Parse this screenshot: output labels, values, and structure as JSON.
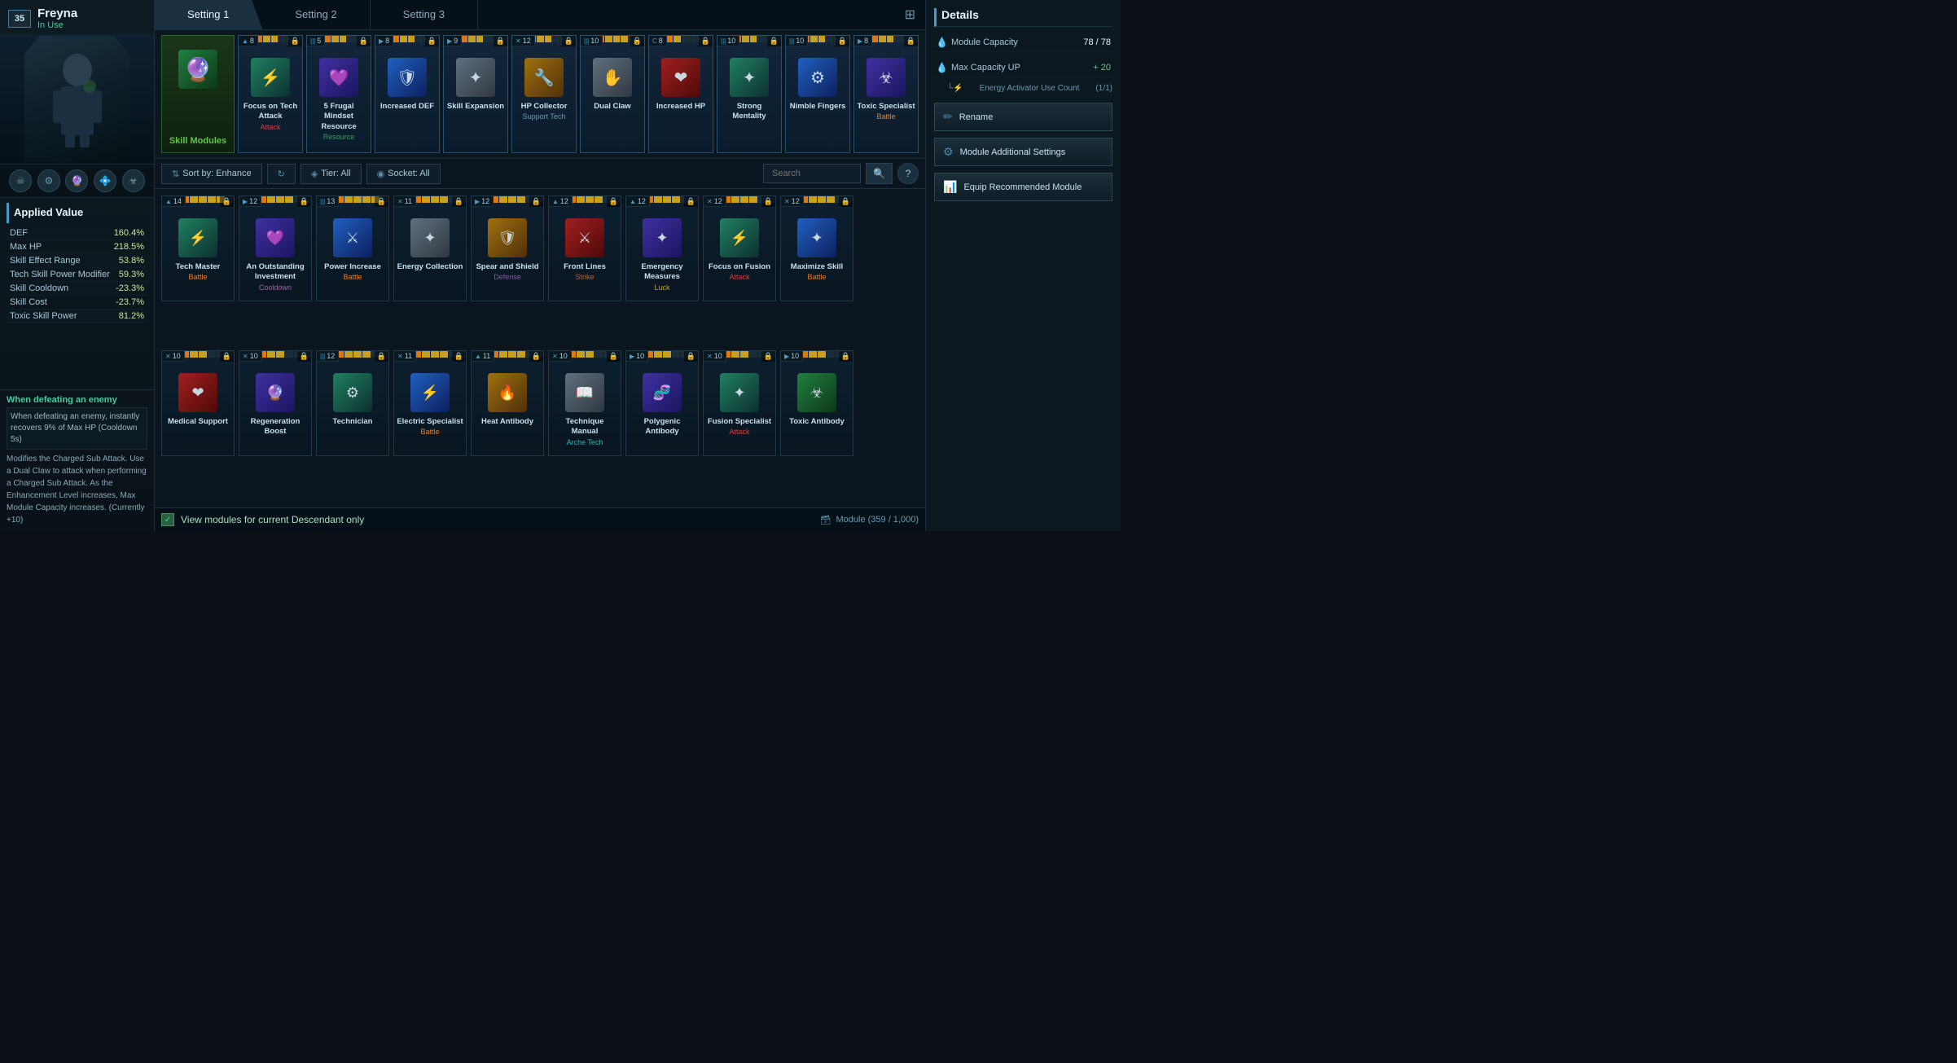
{
  "character": {
    "level": "35",
    "name": "Freyna",
    "status": "In Use"
  },
  "tabs": [
    {
      "label": "Setting 1",
      "active": true
    },
    {
      "label": "Setting 2",
      "active": false
    },
    {
      "label": "Setting 3",
      "active": false
    }
  ],
  "details": {
    "title": "Details",
    "module_capacity_label": "Module Capacity",
    "module_capacity_value": "78 / 78",
    "max_capacity_label": "Max Capacity UP",
    "max_capacity_value": "+ 20",
    "energy_label": "Energy Activator Use Count",
    "energy_value": "(1/1)",
    "rename_btn": "Rename",
    "module_settings_btn": "Module Additional Settings",
    "equip_recommended_btn": "Equip Recommended Module"
  },
  "applied_value": {
    "title": "Applied Value",
    "stats": [
      {
        "name": "DEF",
        "value": "160.4%"
      },
      {
        "name": "Max HP",
        "value": "218.5%"
      },
      {
        "name": "Skill Effect Range",
        "value": "53.8%"
      },
      {
        "name": "Tech Skill Power Modifier",
        "value": "59.3%"
      },
      {
        "name": "Skill Cooldown",
        "value": "-23.3%"
      },
      {
        "name": "Skill Cost",
        "value": "-23.7%"
      },
      {
        "name": "Toxic Skill Power",
        "value": "81.2%"
      }
    ]
  },
  "ability": {
    "trigger": "When defeating an enemy",
    "description": "When defeating an enemy, instantly recovers 9% of Max HP (Cooldown 5s)",
    "detail": "Modifies the Charged Sub Attack.\nUse a Dual Claw to attack when performing a Charged Sub Attack.\nAs the Enhancement Level increases, Max Module Capacity increases. (Currently +10)"
  },
  "equipped_modules": [
    {
      "name": "Skill Modules",
      "type": "",
      "level": "",
      "tier": 0,
      "art": "🔮",
      "art_class": "art-green",
      "special": true
    },
    {
      "name": "Focus on Tech\nAttack",
      "type": "Attack",
      "level": "8",
      "level_icon": "▲",
      "tier": 5,
      "art": "⚡",
      "art_class": "art-teal"
    },
    {
      "name": "5 Frugal Mindset\nResource",
      "type": "Resource",
      "level": "5",
      "level_icon": "|||",
      "tier": 5,
      "art": "💜",
      "art_class": "art-purple"
    },
    {
      "name": "Increased DEF",
      "type": "",
      "level": "8",
      "level_icon": "▶",
      "tier": 5,
      "art": "🛡",
      "art_class": "art-blue"
    },
    {
      "name": "Skill Expansion",
      "type": "",
      "level": "9",
      "level_icon": "▶",
      "tier": 5,
      "art": "✦",
      "art_class": "art-silver"
    },
    {
      "name": "HP Collector",
      "type": "Support Tech",
      "level": "12",
      "level_icon": "✕",
      "tier": 5,
      "art": "🔧",
      "art_class": "art-gold"
    },
    {
      "name": "Dual Claw",
      "type": "",
      "level": "10",
      "level_icon": "|||",
      "tier": 6,
      "art": "✋",
      "art_class": "art-silver"
    },
    {
      "name": "Increased HP",
      "type": "",
      "level": "8",
      "level_icon": "C",
      "tier": 4,
      "art": "❤",
      "art_class": "art-red"
    },
    {
      "name": "Strong Mentality",
      "type": "",
      "level": "10",
      "level_icon": "|||",
      "tier": 5,
      "art": "✦",
      "art_class": "art-teal"
    },
    {
      "name": "Nimble Fingers",
      "type": "",
      "level": "10",
      "level_icon": "|||",
      "tier": 5,
      "art": "⚙",
      "art_class": "art-blue"
    },
    {
      "name": "Toxic Specialist",
      "type": "Battle",
      "level": "8",
      "level_icon": "▶",
      "tier": 5,
      "art": "☣",
      "art_class": "art-purple"
    }
  ],
  "filter": {
    "sort_label": "Sort by: Enhance",
    "tier_label": "Tier: All",
    "socket_label": "Socket: All",
    "search_placeholder": "Search"
  },
  "grid_modules": [
    {
      "name": "Tech Master",
      "type": "Battle",
      "level": "14",
      "level_icon": "▲",
      "tier": 7,
      "art": "⚡",
      "art_class": "art-teal"
    },
    {
      "name": "An Outstanding Investment",
      "type": "Cooldown",
      "level": "12",
      "level_icon": "▶",
      "tier": 6,
      "art": "💜",
      "art_class": "art-purple"
    },
    {
      "name": "Power Increase",
      "type": "Battle",
      "level": "13",
      "level_icon": "|||",
      "tier": 7,
      "art": "⚔",
      "art_class": "art-blue"
    },
    {
      "name": "Energy Collection",
      "type": "",
      "level": "11",
      "level_icon": "✕",
      "tier": 6,
      "art": "✦",
      "art_class": "art-silver"
    },
    {
      "name": "Spear and Shield",
      "type": "Defense",
      "level": "12",
      "level_icon": "▶",
      "tier": 6,
      "art": "🛡",
      "art_class": "art-gold"
    },
    {
      "name": "Front Lines",
      "type": "Strike",
      "level": "12",
      "level_icon": "▲",
      "tier": 6,
      "art": "⚔",
      "art_class": "art-red"
    },
    {
      "name": "Emergency Measures",
      "type": "Luck",
      "level": "12",
      "level_icon": "▲",
      "tier": 6,
      "art": "✦",
      "art_class": "art-purple"
    },
    {
      "name": "Focus on Fusion",
      "type": "Attack",
      "level": "12",
      "level_icon": "✕",
      "tier": 6,
      "art": "⚡",
      "art_class": "art-teal"
    },
    {
      "name": "Maximize Skill",
      "type": "Battle",
      "level": "12",
      "level_icon": "✕",
      "tier": 6,
      "art": "✦",
      "art_class": "art-blue"
    },
    {
      "name": "Medical Support",
      "type": "",
      "level": "10",
      "level_icon": "✕",
      "tier": 5,
      "art": "❤",
      "art_class": "art-red"
    },
    {
      "name": "Regeneration Boost",
      "type": "",
      "level": "10",
      "level_icon": "✕",
      "tier": 5,
      "art": "🔮",
      "art_class": "art-purple"
    },
    {
      "name": "Technician",
      "type": "",
      "level": "12",
      "level_icon": "|||",
      "tier": 6,
      "art": "⚙",
      "art_class": "art-teal"
    },
    {
      "name": "Electric Specialist",
      "type": "Battle",
      "level": "11",
      "level_icon": "✕",
      "tier": 6,
      "art": "⚡",
      "art_class": "art-blue"
    },
    {
      "name": "Heat Antibody",
      "type": "",
      "level": "11",
      "level_icon": "▲",
      "tier": 6,
      "art": "🔥",
      "art_class": "art-gold"
    },
    {
      "name": "Technique Manual",
      "type": "Arche Tech",
      "level": "10",
      "level_icon": "✕",
      "tier": 5,
      "art": "📖",
      "art_class": "art-silver"
    },
    {
      "name": "Polygenic Antibody",
      "type": "",
      "level": "10",
      "level_icon": "▶",
      "tier": 5,
      "art": "🧬",
      "art_class": "art-purple"
    },
    {
      "name": "Fusion Specialist",
      "type": "Attack",
      "level": "10",
      "level_icon": "✕",
      "tier": 5,
      "art": "✦",
      "art_class": "art-teal"
    },
    {
      "name": "Toxic Antibody",
      "type": "",
      "level": "10",
      "level_icon": "▶",
      "tier": 5,
      "art": "☣",
      "art_class": "art-green"
    }
  ],
  "bottom": {
    "checkbox_label": "View modules for current Descendant only",
    "module_count_icon": "🗃",
    "module_count": "Module (359 / 1,000)"
  }
}
